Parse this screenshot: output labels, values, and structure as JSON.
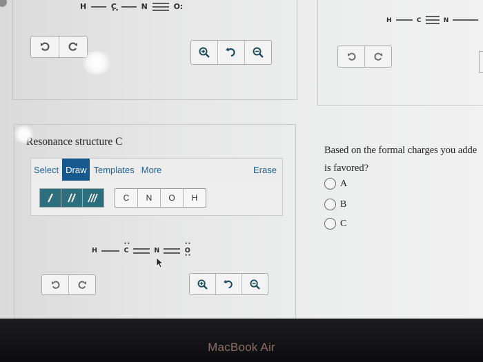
{
  "top_left_molecule": {
    "h": "H",
    "c": "C",
    "c_dots": "••",
    "n": "N",
    "o": "O:"
  },
  "top_right_molecule": {
    "h": "H",
    "c": "C",
    "n": "N"
  },
  "icons": {
    "undo": "undo-icon",
    "redo": "redo-icon",
    "zoom_in": "zoom-in-icon",
    "reset": "reset-zoom-icon",
    "zoom_out": "zoom-out-icon"
  },
  "panel_c": {
    "title": "Resonance structure C",
    "tabs": [
      "Select",
      "Draw",
      "Templates",
      "More"
    ],
    "active_tab": "Draw",
    "erase": "Erase",
    "atoms": [
      "C",
      "N",
      "O",
      "H"
    ],
    "molecule": {
      "h": "H",
      "c": "C",
      "n": "N",
      "o": "O"
    }
  },
  "question": {
    "line1": "Based on the formal charges you adde",
    "line2": "is favored?",
    "options": [
      "A",
      "B",
      "C"
    ]
  },
  "bezel": {
    "brand": "MacBook Air"
  },
  "colors": {
    "active_tab": "#17598f",
    "bond_buttons": "#2f6f7d",
    "link": "#1f5f8f"
  }
}
